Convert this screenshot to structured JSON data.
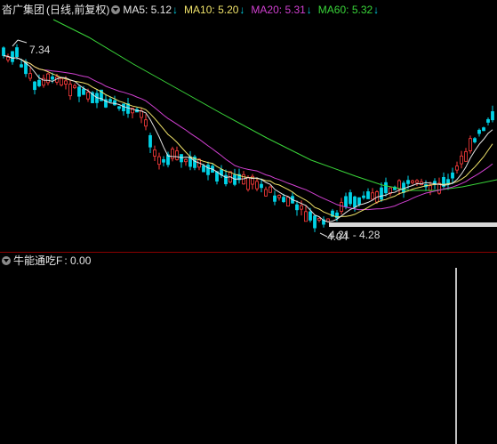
{
  "header": {
    "stock_name": "沓广集团",
    "period": "(日线,前复权)",
    "mas": [
      {
        "label": "MA5: 5.12",
        "arrow": "↓",
        "color": "#e6e6e6"
      },
      {
        "label": "MA10: 5.20",
        "arrow": "↓",
        "color": "#f0e36a"
      },
      {
        "label": "MA20: 5.31",
        "arrow": "↓",
        "color": "#d040d0"
      },
      {
        "label": "MA60: 5.32",
        "arrow": "↓",
        "color": "#39d439"
      }
    ]
  },
  "annotations": {
    "high_label": "7.34",
    "low_label": "4.04",
    "range_label": "4.21 - 4.28"
  },
  "indicator": {
    "name": "牛能通吃F",
    "value_text": ": 0.00"
  },
  "colors": {
    "up": "#ff3c3c",
    "down": "#00d2e6",
    "ma5": "#e6e6e6",
    "ma10": "#f0e36a",
    "ma20": "#d040d0",
    "ma60": "#39d439",
    "separator": "#8b0000",
    "indicator_bar": "#ffffff"
  }
}
